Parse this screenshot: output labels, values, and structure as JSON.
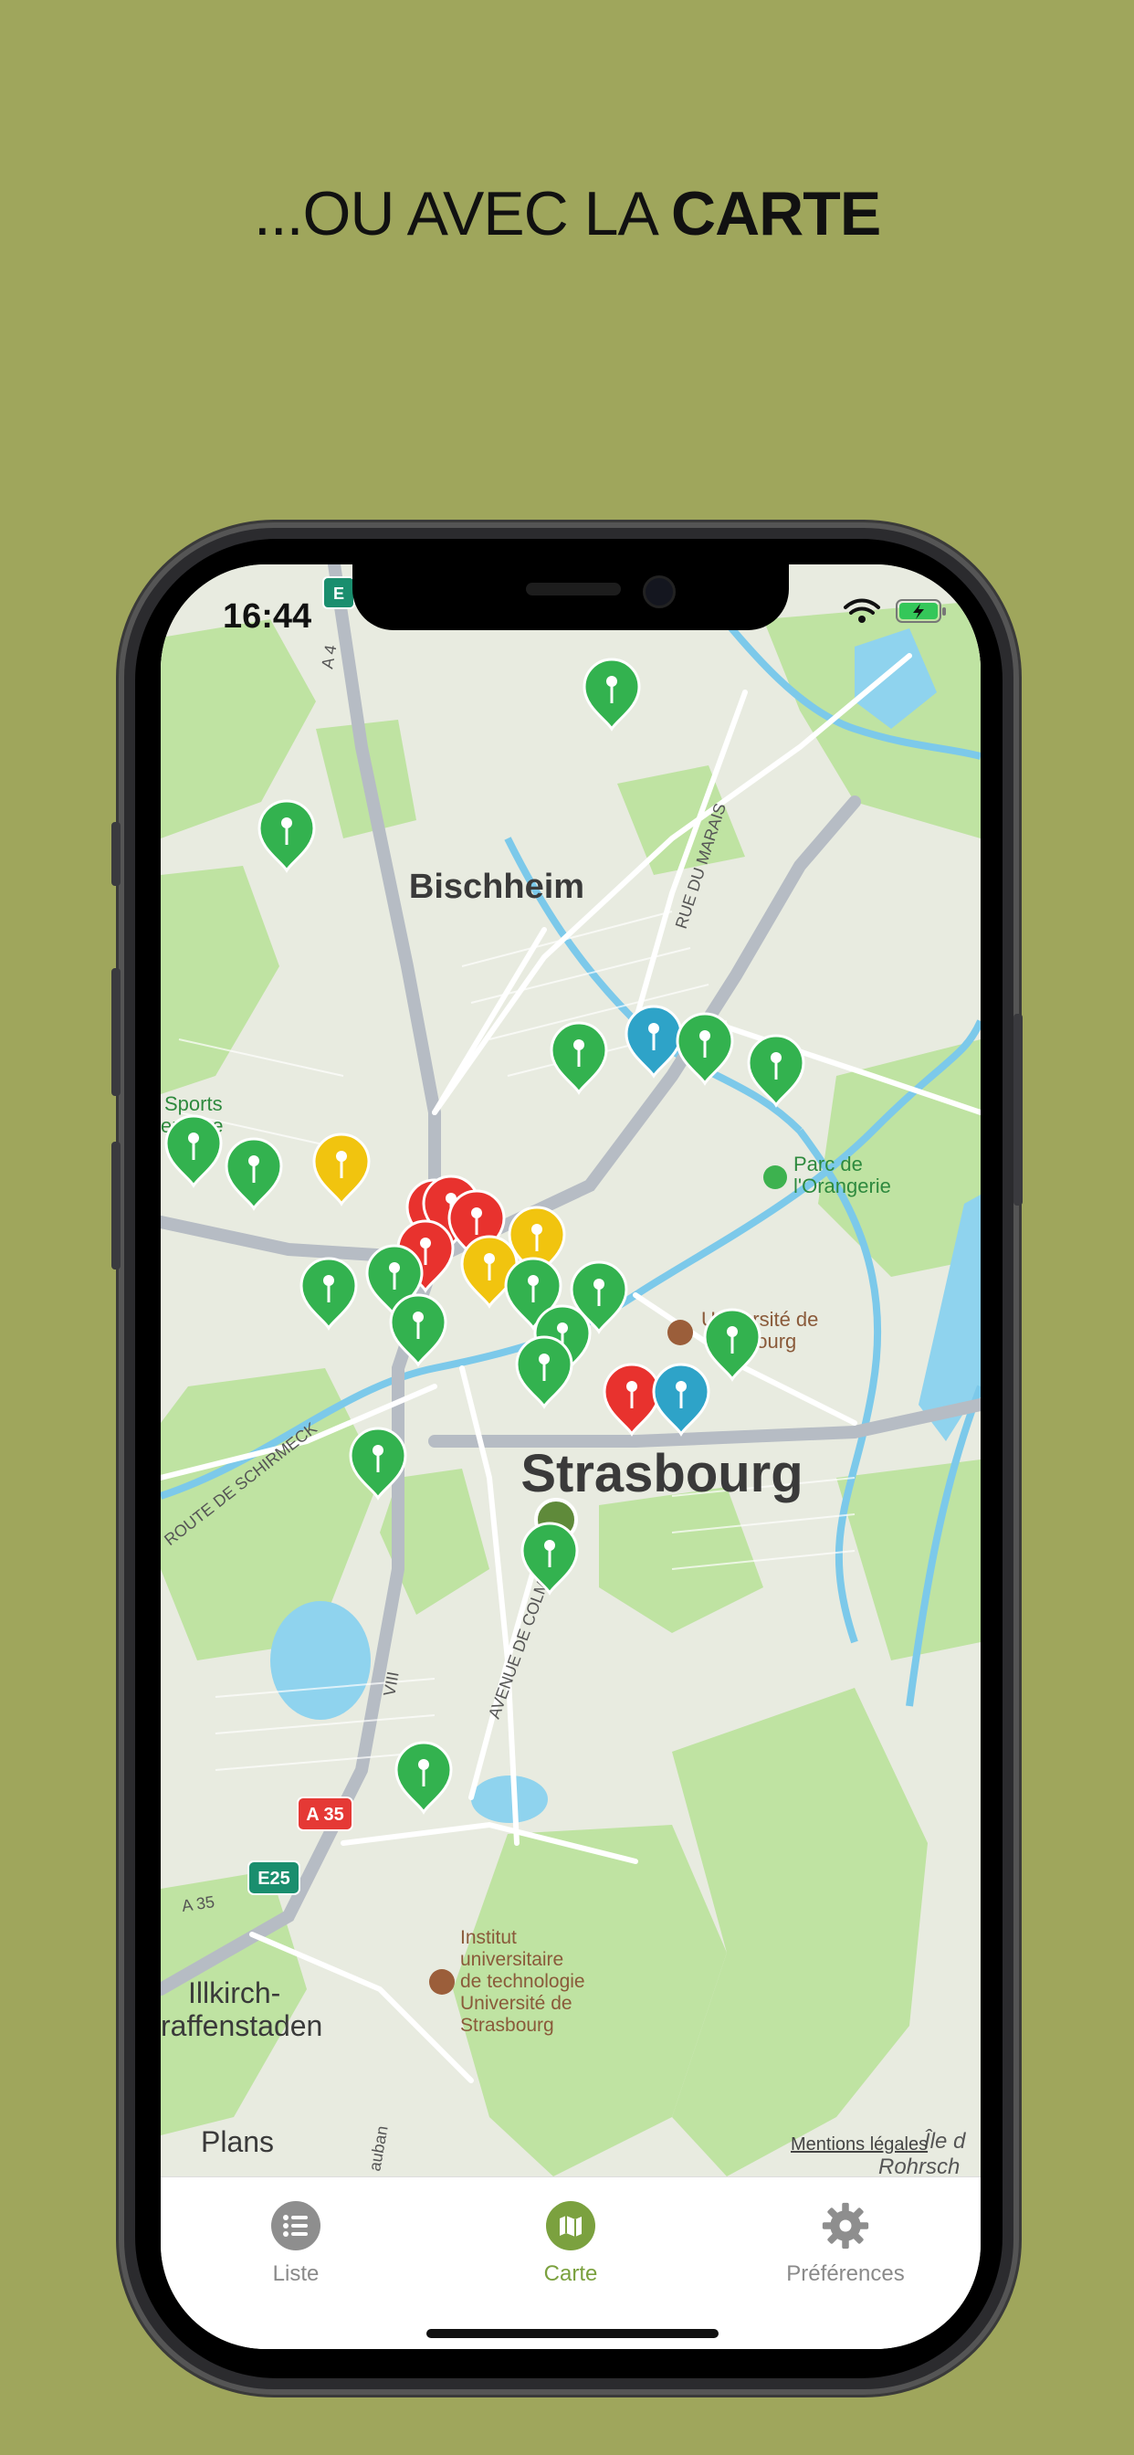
{
  "headline": {
    "prefix": "...OU AVEC LA ",
    "bold": "CARTE"
  },
  "status_bar": {
    "time": "16:44"
  },
  "map": {
    "labels": {
      "bischheim": "Bischheim",
      "strasbourg": "Strasbourg",
      "sports": "Sports",
      "sports2": "epierre",
      "parc1": "Parc de",
      "parc2": "l'Orangerie",
      "univ1": "Université de",
      "univ2": "bourg",
      "iut1": "Institut",
      "iut2": "universitaire",
      "iut3": "de technologie",
      "iut4": "Université de",
      "iut5": "Strasbourg",
      "illkirch1": "Illkirch-",
      "illkirch2": "raffenstaden",
      "rue_marais": "RUE DU MARAIS",
      "route_schirmeck": "ROUTE DE SCHIRMECK",
      "avenue": "AVENUE DE COLMAR",
      "a4": "A 4",
      "a35_shield": "A 35",
      "a35": "A 35",
      "e25": "E25",
      "e_top": "E",
      "vill": "VIII",
      "auban": "auban",
      "rohrsch": "Rohrsch",
      "ile": "Île d",
      "plans": "Plans",
      "legal": "Mentions légales"
    },
    "colors": {
      "green": "#33b24f",
      "red": "#e8322e",
      "yellow": "#f1c40f",
      "blue": "#2ea3c8",
      "park": "#b8e19a",
      "water": "#8fd3ee"
    }
  },
  "tabs": [
    {
      "label": "Liste",
      "icon": "list-icon",
      "active": false
    },
    {
      "label": "Carte",
      "icon": "map-icon",
      "active": true
    },
    {
      "label": "Préférences",
      "icon": "gear-icon",
      "active": false
    }
  ],
  "brand_colors": {
    "background": "#9fa65c",
    "accent": "#7ba13f"
  }
}
